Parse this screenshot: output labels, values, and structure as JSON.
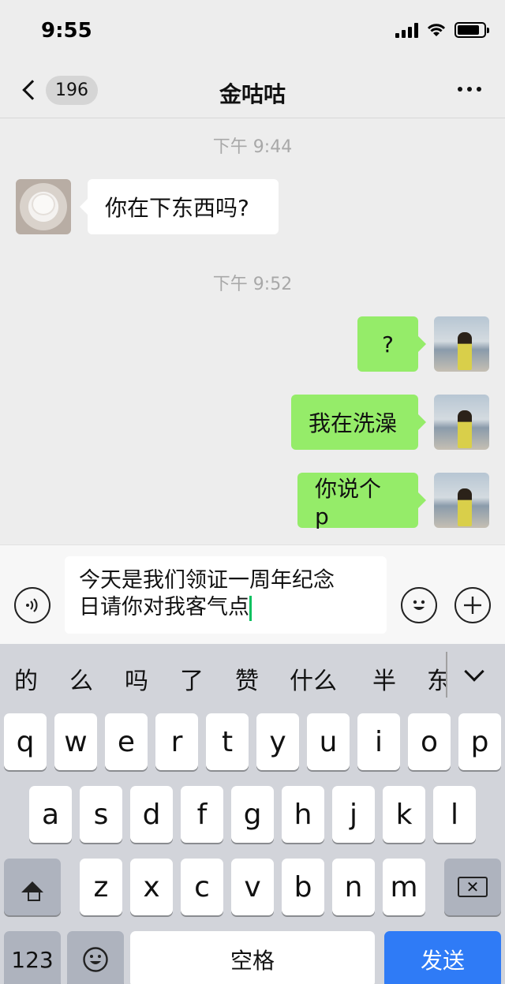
{
  "status": {
    "time": "9:55"
  },
  "nav": {
    "unread": "196",
    "title": "金咕咕"
  },
  "messages": [
    {
      "type": "time",
      "text": "下午 9:44"
    },
    {
      "type": "in",
      "text": "你在下东西吗?"
    },
    {
      "type": "time",
      "text": "下午 9:52"
    },
    {
      "type": "out",
      "text": "?"
    },
    {
      "type": "out",
      "text": "我在洗澡"
    },
    {
      "type": "out",
      "text": "你说个 p"
    }
  ],
  "input": {
    "value_line1": "今天是我们领证一周年纪念",
    "value_line2": "日请你对我客气点"
  },
  "keyboard": {
    "candidates": [
      "的",
      "么",
      "吗",
      "了",
      "赞",
      "什么",
      "半",
      "东"
    ],
    "row1": [
      "q",
      "w",
      "e",
      "r",
      "t",
      "y",
      "u",
      "i",
      "o",
      "p"
    ],
    "row2": [
      "a",
      "s",
      "d",
      "f",
      "g",
      "h",
      "j",
      "k",
      "l"
    ],
    "row3": [
      "z",
      "x",
      "c",
      "v",
      "b",
      "n",
      "m"
    ],
    "numbers_label": "123",
    "space_label": "空格",
    "send_label": "发送"
  },
  "colors": {
    "outgoing_bubble": "#95ec69",
    "send_key": "#2f7bf6",
    "caret": "#07c160"
  }
}
